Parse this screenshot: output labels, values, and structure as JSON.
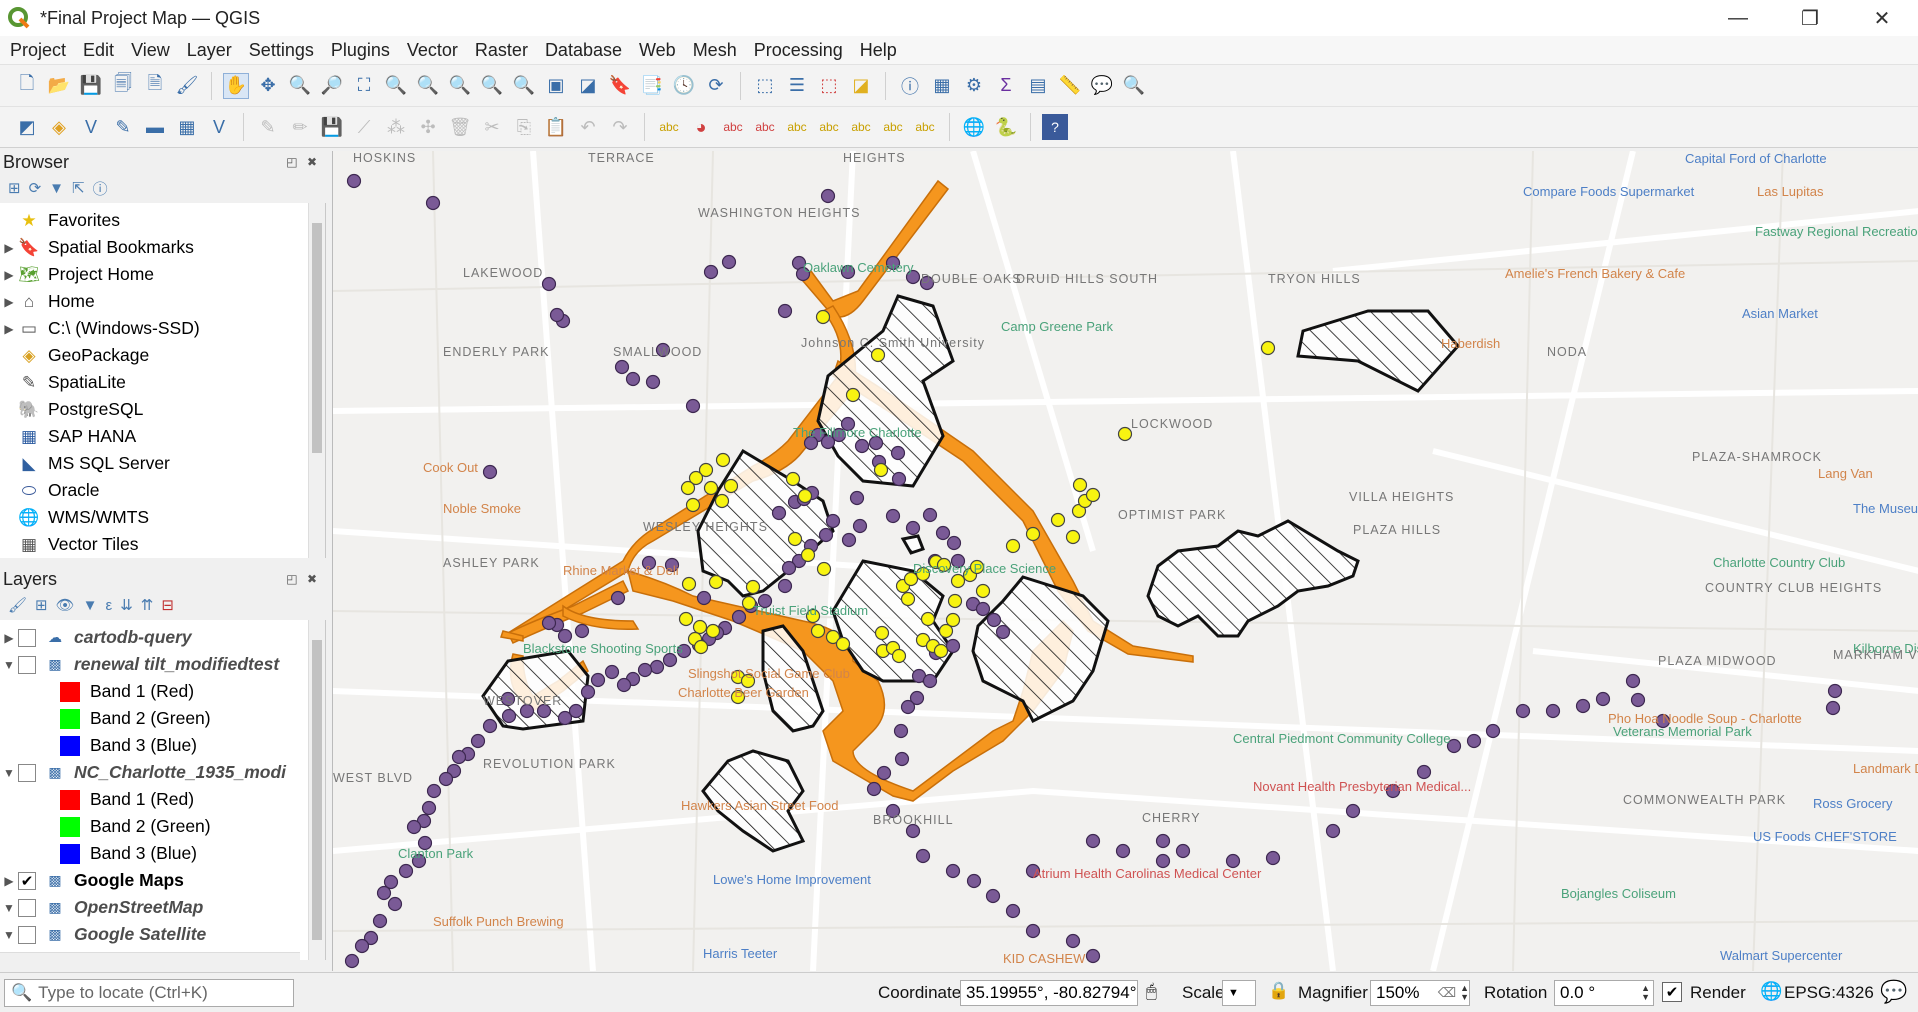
{
  "window": {
    "title": "*Final Project Map — QGIS",
    "controls": [
      "—",
      "❐",
      "✕"
    ]
  },
  "menu": [
    "Project",
    "Edit",
    "View",
    "Layer",
    "Settings",
    "Plugins",
    "Vector",
    "Raster",
    "Database",
    "Web",
    "Mesh",
    "Processing",
    "Help"
  ],
  "browser": {
    "title": "Browser",
    "items": [
      {
        "label": "Favorites",
        "icon": "star-icon",
        "arrow": ""
      },
      {
        "label": "Spatial Bookmarks",
        "icon": "bookmark-icon",
        "arrow": "▶"
      },
      {
        "label": "Project Home",
        "icon": "project-home-icon",
        "arrow": "▶"
      },
      {
        "label": "Home",
        "icon": "home-folder-icon",
        "arrow": "▶"
      },
      {
        "label": "C:\\ (Windows-SSD)",
        "icon": "drive-icon",
        "arrow": "▶"
      },
      {
        "label": "GeoPackage",
        "icon": "geopackage-icon",
        "arrow": ""
      },
      {
        "label": "SpatiaLite",
        "icon": "spatialite-icon",
        "arrow": ""
      },
      {
        "label": "PostgreSQL",
        "icon": "postgresql-icon",
        "arrow": ""
      },
      {
        "label": "SAP HANA",
        "icon": "sap-hana-icon",
        "arrow": ""
      },
      {
        "label": "MS SQL Server",
        "icon": "mssql-icon",
        "arrow": ""
      },
      {
        "label": "Oracle",
        "icon": "oracle-icon",
        "arrow": ""
      },
      {
        "label": "WMS/WMTS",
        "icon": "wms-icon",
        "arrow": ""
      },
      {
        "label": "Vector Tiles",
        "icon": "vector-tiles-icon",
        "arrow": ""
      }
    ]
  },
  "layers": {
    "title": "Layers",
    "items": [
      {
        "label": "cartodb-query",
        "kind": "layer",
        "arrow": "▶",
        "checked": false,
        "icon": "vector-layer-icon"
      },
      {
        "label": "renewal tilt_modifiedtest",
        "kind": "layer",
        "arrow": "▼",
        "checked": false,
        "icon": "raster-layer-icon"
      },
      {
        "label": "Band 1 (Red)",
        "kind": "band",
        "color": "#ff0000"
      },
      {
        "label": "Band 2 (Green)",
        "kind": "band",
        "color": "#00ff00"
      },
      {
        "label": "Band 3 (Blue)",
        "kind": "band",
        "color": "#0000ff"
      },
      {
        "label": "NC_Charlotte_1935_modi",
        "kind": "layer",
        "arrow": "▼",
        "checked": false,
        "icon": "raster-layer-icon"
      },
      {
        "label": "Band 1 (Red)",
        "kind": "band",
        "color": "#ff0000"
      },
      {
        "label": "Band 2 (Green)",
        "kind": "band",
        "color": "#00ff00"
      },
      {
        "label": "Band 3 (Blue)",
        "kind": "band",
        "color": "#0000ff"
      },
      {
        "label": "Google Maps",
        "kind": "layer",
        "arrow": "▶",
        "checked": true,
        "icon": "raster-layer-icon"
      },
      {
        "label": "OpenStreetMap",
        "kind": "layer",
        "arrow": "▼",
        "checked": false,
        "icon": "raster-layer-icon"
      },
      {
        "label": "Google Satellite",
        "kind": "layer",
        "arrow": "▼",
        "checked": false,
        "icon": "raster-layer-icon"
      }
    ]
  },
  "map": {
    "labels": [
      {
        "t": "HOSKINS",
        "c": ""
      },
      {
        "t": "TERRACE",
        "c": ""
      },
      {
        "t": "HEIGHTS",
        "c": ""
      },
      {
        "t": "WASHINGTON HEIGHTS",
        "c": ""
      },
      {
        "t": "Oaklawn Cemetery",
        "c": "park"
      },
      {
        "t": "LAKEWOOD",
        "c": ""
      },
      {
        "t": "DOUBLE OAKS",
        "c": ""
      },
      {
        "t": "DRUID HILLS SOUTH",
        "c": ""
      },
      {
        "t": "TRYON HILLS",
        "c": ""
      },
      {
        "t": "Compare Foods Supermarket",
        "c": "blue"
      },
      {
        "t": "Capital Ford of Charlotte",
        "c": "blue"
      },
      {
        "t": "Las Lupitas",
        "c": "poi"
      },
      {
        "t": "Fastway Regional Recreation Center",
        "c": "park"
      },
      {
        "t": "Amelie's French Bakery & Cafe",
        "c": "poi"
      },
      {
        "t": "Asian Market",
        "c": "blue"
      },
      {
        "t": "ENDERLY PARK",
        "c": ""
      },
      {
        "t": "SMALLWOOD",
        "c": ""
      },
      {
        "t": "Johnson C. Smith University",
        "c": ""
      },
      {
        "t": "Camp Greene Park",
        "c": "park"
      },
      {
        "t": "Haberdish",
        "c": "poi"
      },
      {
        "t": "NODA",
        "c": ""
      },
      {
        "t": "LOCKWOOD",
        "c": ""
      },
      {
        "t": "The Fillmore Charlotte",
        "c": "park"
      },
      {
        "t": "Cook Out",
        "c": "poi"
      },
      {
        "t": "PLAZA-SHAMROCK",
        "c": ""
      },
      {
        "t": "Lang Van",
        "c": "poi"
      },
      {
        "t": "Noble Smoke",
        "c": "poi"
      },
      {
        "t": "OPTIMIST PARK",
        "c": ""
      },
      {
        "t": "VILLA HEIGHTS",
        "c": ""
      },
      {
        "t": "WESLEY HEIGHTS",
        "c": ""
      },
      {
        "t": "ASHLEY PARK",
        "c": ""
      },
      {
        "t": "PLAZA HILLS",
        "c": ""
      },
      {
        "t": "Charlotte Country Club",
        "c": "park"
      },
      {
        "t": "Rhine Market & Deli",
        "c": "poi"
      },
      {
        "t": "Discovery Place Science",
        "c": "park"
      },
      {
        "t": "COUNTRY CLUB HEIGHTS",
        "c": ""
      },
      {
        "t": "Truist Field Stadium",
        "c": "park"
      },
      {
        "t": "Blackstone Shooting Sports",
        "c": "park"
      },
      {
        "t": "Slingshot Social Game Club",
        "c": "poi"
      },
      {
        "t": "Charlotte Beer Garden",
        "c": "poi"
      },
      {
        "t": "WESTOVER",
        "c": ""
      },
      {
        "t": "PLAZA MIDWOOD",
        "c": ""
      },
      {
        "t": "Pho Hoa Noodle Soup - Charlotte",
        "c": "poi"
      },
      {
        "t": "Veterans Memorial Park",
        "c": "park"
      },
      {
        "t": "REVOLUTION PARK",
        "c": ""
      },
      {
        "t": "WEST BLVD",
        "c": ""
      },
      {
        "t": "Central Piedmont Community College",
        "c": "park"
      },
      {
        "t": "Novant Health Presbyterian Medical...",
        "c": "red"
      },
      {
        "t": "COMMONWEALTH PARK",
        "c": ""
      },
      {
        "t": "Ross Grocery",
        "c": "blue"
      },
      {
        "t": "Hawkers Asian Street Food",
        "c": "poi"
      },
      {
        "t": "BROOKHILL",
        "c": ""
      },
      {
        "t": "CHERRY",
        "c": ""
      },
      {
        "t": "US Foods CHEF'STORE",
        "c": "blue"
      },
      {
        "t": "Clanton Park",
        "c": "park"
      },
      {
        "t": "Lowe's Home Improvement",
        "c": "blue"
      },
      {
        "t": "Atrium Health Carolinas Medical Center",
        "c": "red"
      },
      {
        "t": "Bojangles Coliseum",
        "c": "park"
      },
      {
        "t": "Suffolk Punch Brewing",
        "c": "poi"
      },
      {
        "t": "Harris Teeter",
        "c": "blue"
      },
      {
        "t": "KID CASHEW",
        "c": "poi"
      },
      {
        "t": "Walmart Supercenter",
        "c": "blue"
      },
      {
        "t": "The Museum of...",
        "c": "blue"
      },
      {
        "t": "Kilborne District",
        "c": "park"
      },
      {
        "t": "Landmark Diner",
        "c": "poi"
      },
      {
        "t": "MARKHAM VILLAGE",
        "c": ""
      }
    ]
  },
  "status": {
    "locate_placeholder": "Type to locate (Ctrl+K)",
    "coordinate_label": "Coordinate",
    "coordinate_value": "35.19955°, -80.82794°",
    "scale_label": "Scale",
    "magnifier_label": "Magnifier",
    "magnifier_value": "150%",
    "rotation_label": "Rotation",
    "rotation_value": "0.0 °",
    "render_label": "Render",
    "crs": "EPSG:4326"
  },
  "colors": {
    "highway": "#f5961e",
    "hatch_outline": "#222222",
    "yellow_point": "#f8f411",
    "purple_point": "#7a5a96"
  }
}
